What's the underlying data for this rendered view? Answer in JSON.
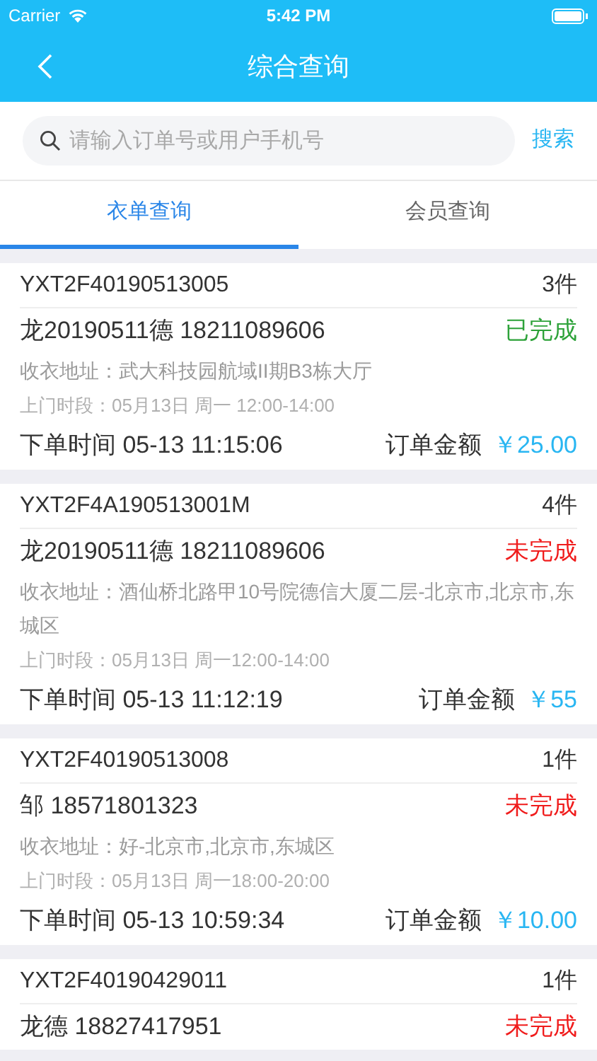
{
  "status_bar": {
    "carrier": "Carrier",
    "time": "5:42 PM"
  },
  "nav": {
    "title": "综合查询"
  },
  "search": {
    "placeholder": "请输入订单号或用户手机号",
    "button": "搜索"
  },
  "tabs": [
    {
      "label": "衣单查询",
      "selected": true
    },
    {
      "label": "会员查询",
      "selected": false
    }
  ],
  "orders": [
    {
      "order_no": "YXT2F40190513005",
      "count": "3件",
      "customer": "龙20190511德 18211089606",
      "status": "已完成",
      "kind": "done",
      "address": "收衣地址：武大科技园航域II期B3栋大厅",
      "slot": "上门时段：05月13日 周一 12:00-14:00",
      "order_time": "下单时间 05-13 11:15:06",
      "amount_label": "订单金额",
      "amount": "￥25.00"
    },
    {
      "order_no": "YXT2F4A190513001M",
      "count": "4件",
      "customer": "龙20190511德 18211089606",
      "status": "未完成",
      "kind": "pending",
      "address": "收衣地址：酒仙桥北路甲10号院德信大厦二层-北京市,北京市,东城区",
      "slot": "上门时段：05月13日 周一12:00-14:00",
      "order_time": "下单时间 05-13 11:12:19",
      "amount_label": "订单金额",
      "amount": "￥55"
    },
    {
      "order_no": "YXT2F40190513008",
      "count": "1件",
      "customer": "邹 18571801323",
      "status": "未完成",
      "kind": "pending",
      "address": "收衣地址：好-北京市,北京市,东城区",
      "slot": "上门时段：05月13日 周一18:00-20:00",
      "order_time": "下单时间 05-13 10:59:34",
      "amount_label": "订单金额",
      "amount": "￥10.00"
    },
    {
      "order_no": "YXT2F40190429011",
      "count": "1件",
      "customer": "龙德 18827417951",
      "status": "未完成",
      "kind": "pending"
    }
  ]
}
